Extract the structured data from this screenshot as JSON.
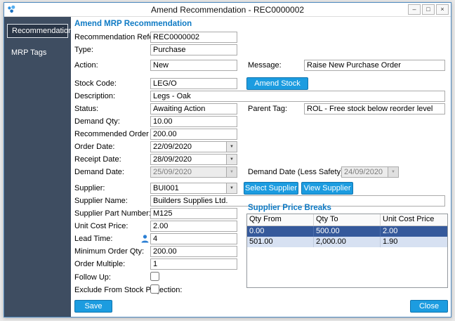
{
  "window": {
    "title": "Amend Recommendation - REC0000002",
    "minimize": "–",
    "maximize": "□",
    "close": "×"
  },
  "sidebar": {
    "items": [
      {
        "label": "Recommendation",
        "selected": true
      },
      {
        "label": "MRP Tags",
        "selected": false
      }
    ]
  },
  "icons": {
    "chevron_down": "▼"
  },
  "form": {
    "heading": "Amend MRP Recommendation",
    "fields": {
      "reference": {
        "label": "Recommendation Reference:",
        "value": "REC0000002"
      },
      "type": {
        "label": "Type:",
        "value": "Purchase"
      },
      "action": {
        "label": "Action:",
        "value": "New"
      },
      "message": {
        "label": "Message:",
        "value": "Raise New Purchase Order"
      },
      "stock_code": {
        "label": "Stock Code:",
        "value": "LEG/O"
      },
      "description": {
        "label": "Description:",
        "value": "Legs - Oak"
      },
      "status": {
        "label": "Status:",
        "value": "Awaiting Action"
      },
      "parent_tag": {
        "label": "Parent Tag:",
        "value": "ROL - Free stock below reorder level"
      },
      "demand_qty": {
        "label": "Demand Qty:",
        "value": "10.00"
      },
      "recommended_order_qty": {
        "label": "Recommended Order Qty:",
        "value": "200.00"
      },
      "order_date": {
        "label": "Order Date:",
        "value": "22/09/2020"
      },
      "receipt_date": {
        "label": "Receipt Date:",
        "value": "28/09/2020"
      },
      "demand_date": {
        "label": "Demand Date:",
        "value": "25/09/2020"
      },
      "demand_date_less_safety": {
        "label": "Demand Date (Less Safety):",
        "value": "24/09/2020"
      },
      "supplier": {
        "label": "Supplier:",
        "value": "BUI001"
      },
      "supplier_name": {
        "label": "Supplier Name:",
        "value": "Builders Supplies Ltd."
      },
      "supplier_part_number": {
        "label": "Supplier Part Number:",
        "value": "M125"
      },
      "unit_cost_price": {
        "label": "Unit Cost Price:",
        "value": "2.00"
      },
      "lead_time": {
        "label": "Lead Time:",
        "value": "4"
      },
      "minimum_order_qty": {
        "label": "Minimum Order Qty:",
        "value": "200.00"
      },
      "order_multiple": {
        "label": "Order Multiple:",
        "value": "1"
      },
      "follow_up": {
        "label": "Follow Up:",
        "checked": false
      },
      "exclude": {
        "label": "Exclude From Stock Projection:",
        "checked": false
      }
    },
    "buttons": {
      "amend_stock": "Amend Stock",
      "select_supplier": "Select Supplier",
      "view_supplier": "View Supplier",
      "save": "Save",
      "close": "Close"
    }
  },
  "price_breaks": {
    "heading": "Supplier Price Breaks",
    "columns": [
      "Qty From",
      "Qty To",
      "Unit Cost Price"
    ],
    "rows": [
      [
        "0.00",
        "500.00",
        "2.00"
      ],
      [
        "501.00",
        "2,000.00",
        "1.90"
      ]
    ],
    "selected_row": 0
  },
  "colors": {
    "accent": "#1c9ce0",
    "accent_border": "#0f74ae",
    "heading": "#0e7ac4",
    "sidebar_bg": "#3e4d61",
    "sidebar_selected_bg": "#2a3647",
    "row_selected_bg": "#35599b",
    "row_alt_bg": "#d7e1f2",
    "window_border": "#4f8ac0"
  }
}
